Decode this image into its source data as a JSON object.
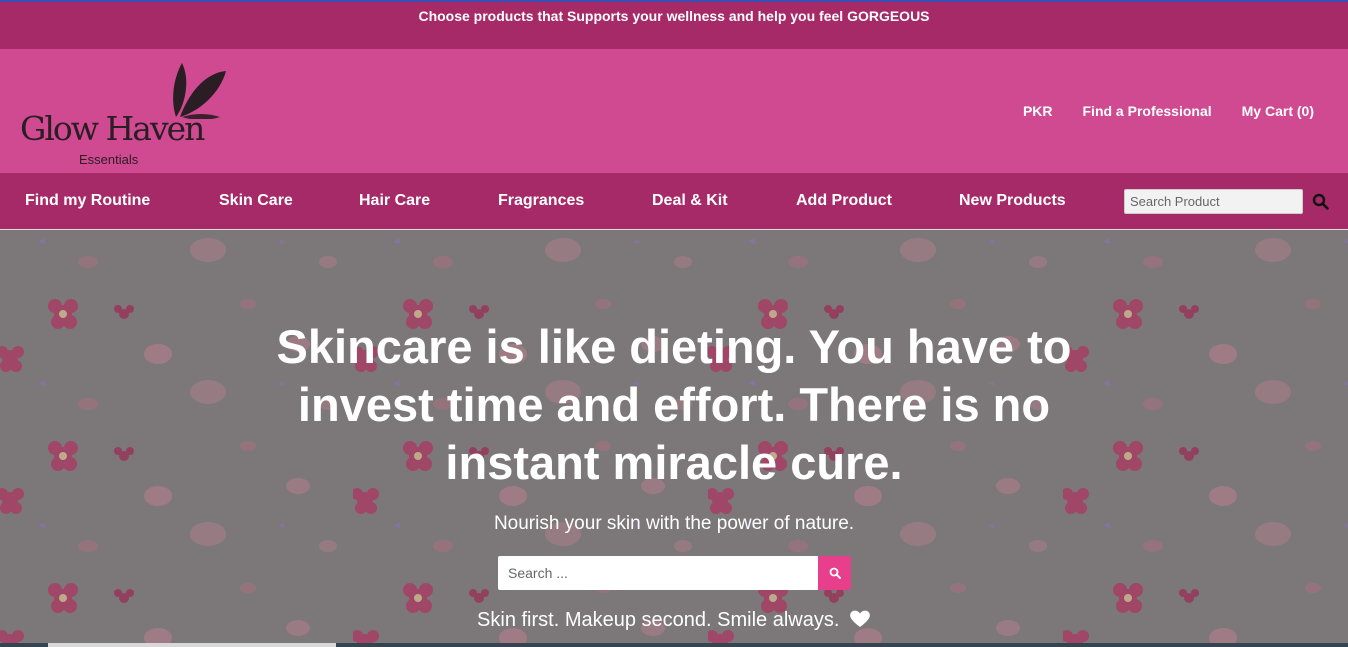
{
  "announcement": "Choose products that Supports your wellness and help you feel GORGEOUS",
  "brand": {
    "name": "Glow Haven",
    "sub": "Essentials",
    "logo_icon": "leaves-icon"
  },
  "header_links": {
    "currency": "PKR",
    "find_professional": "Find a Professional",
    "cart": "My Cart (0)"
  },
  "nav": {
    "items": [
      "Find my Routine",
      "Skin Care",
      "Hair Care",
      "Fragrances",
      "Deal & Kit",
      "Add Product",
      "New Products"
    ],
    "search_placeholder": "Search Product",
    "search_icon": "search-icon"
  },
  "hero": {
    "title": "Skincare is like dieting. You have to invest time and effort. There is no instant miracle cure.",
    "subtitle": "Nourish your skin with the power of nature.",
    "search_placeholder": "Search ...",
    "tagline": "Skin first. Makeup second. Smile always.",
    "tagline_icon": "heart-icon"
  },
  "colors": {
    "top_bar": "#a62a68",
    "header": "#cf4a91",
    "nav": "#a62a68",
    "accent": "#e83f8c",
    "text_light": "#ffffff"
  }
}
